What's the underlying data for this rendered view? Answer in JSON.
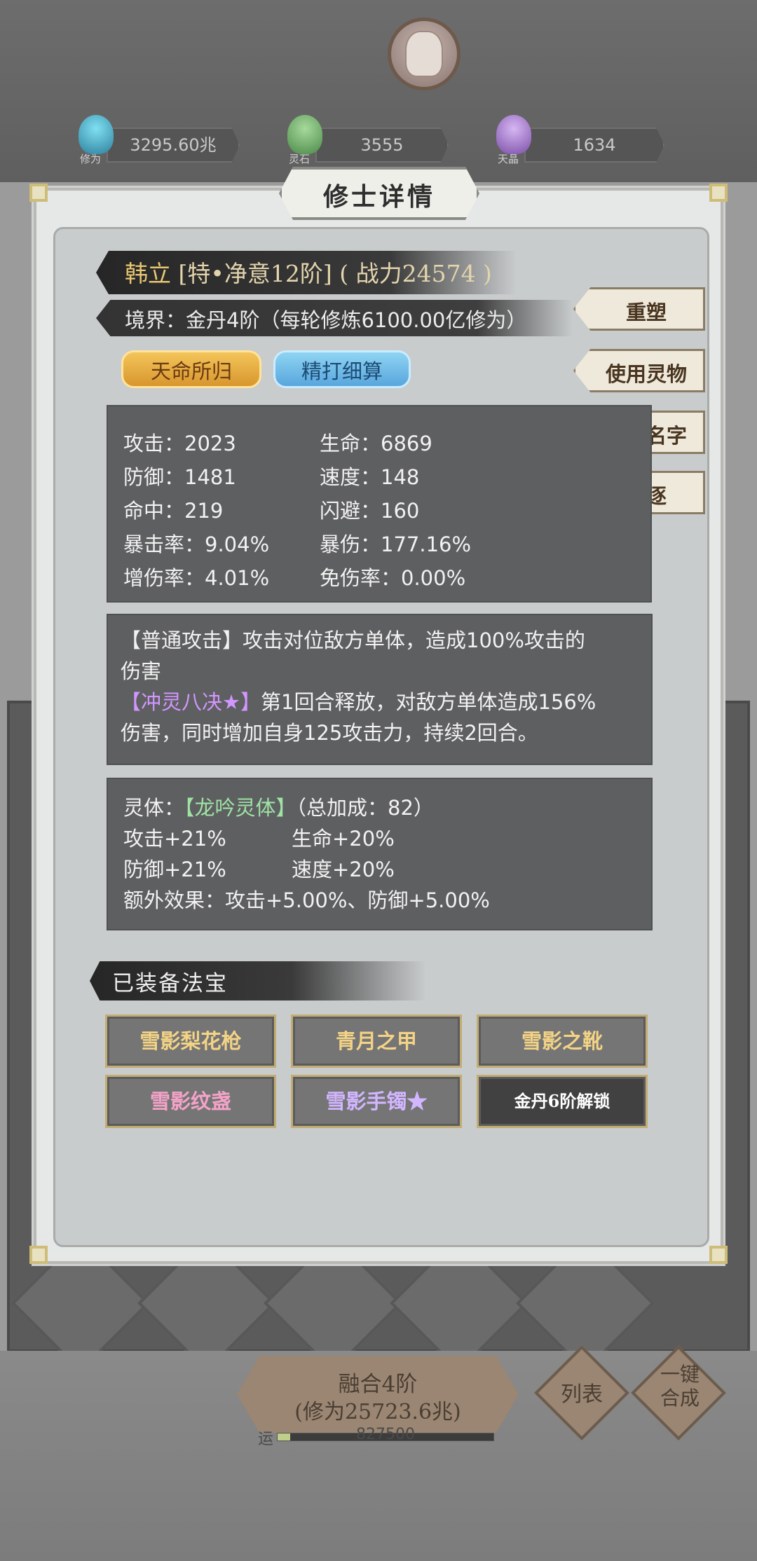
{
  "resources": [
    {
      "label": "修为",
      "value": "3295.60兆",
      "icon": "flame-gem-icon",
      "color": "#4fb6d6"
    },
    {
      "label": "灵石",
      "value": "3555",
      "icon": "green-crystal-icon",
      "color": "#6fae6a"
    },
    {
      "label": "天晶",
      "value": "1634",
      "icon": "purple-crystal-icon",
      "color": "#9a6fc4"
    }
  ],
  "dialog": {
    "title": "修士详情",
    "character": {
      "name": "韩立",
      "rank": "[特•净意12阶]",
      "power": "( 战力24574 )",
      "realm": "境界：金丹4阶（每轮修炼6100.00亿修为）"
    },
    "tags": [
      "天命所归",
      "精打细算"
    ],
    "side_buttons": [
      "重塑",
      "使用灵物",
      "修改名字",
      "驱逐"
    ],
    "stats": [
      {
        "left": "攻击：2023",
        "right": "生命：6869"
      },
      {
        "left": "防御：1481",
        "right": "速度：148"
      },
      {
        "left": "命中：219",
        "right": "闪避：160"
      },
      {
        "left": "暴击率：9.04%",
        "right": "暴伤：177.16%"
      },
      {
        "left": "增伤率：4.01%",
        "right": "免伤率：0.00%"
      }
    ],
    "skills": {
      "normal_name": "【普通攻击】",
      "normal_line1": "攻击对位敌方单体，造成100%攻击的",
      "normal_line2": "伤害",
      "special_name": "【冲灵八决★】",
      "special_line1": "第1回合释放，对敌方单体造成156%",
      "special_line2": "伤害，同时增加自身125攻击力，持续2回合。"
    },
    "spirit_body": {
      "label": "灵体：",
      "name": "【龙吟灵体】",
      "bonus": "（总加成：82）",
      "rows": [
        {
          "left": "攻击+21%",
          "right": "生命+20%"
        },
        {
          "left": "防御+21%",
          "right": "速度+20%"
        }
      ],
      "extra": "额外效果：攻击+5.00%、防御+5.00%"
    },
    "equipment_title": "已装备法宝",
    "equipment": [
      {
        "label": "雪影梨花枪"
      },
      {
        "label": "青月之甲"
      },
      {
        "label": "雪影之靴"
      },
      {
        "label": "雪影纹盏"
      },
      {
        "label": "雪影手镯★"
      },
      {
        "label": "金丹6阶解锁"
      }
    ]
  },
  "bottom": {
    "fuse_title": "融合4阶",
    "fuse_cost": "(修为25723.6兆)",
    "list_label": "列表",
    "one_click_label": "一键合成",
    "progress_label": "运",
    "progress_text": "827500",
    "progress_fraction": 0.06
  }
}
